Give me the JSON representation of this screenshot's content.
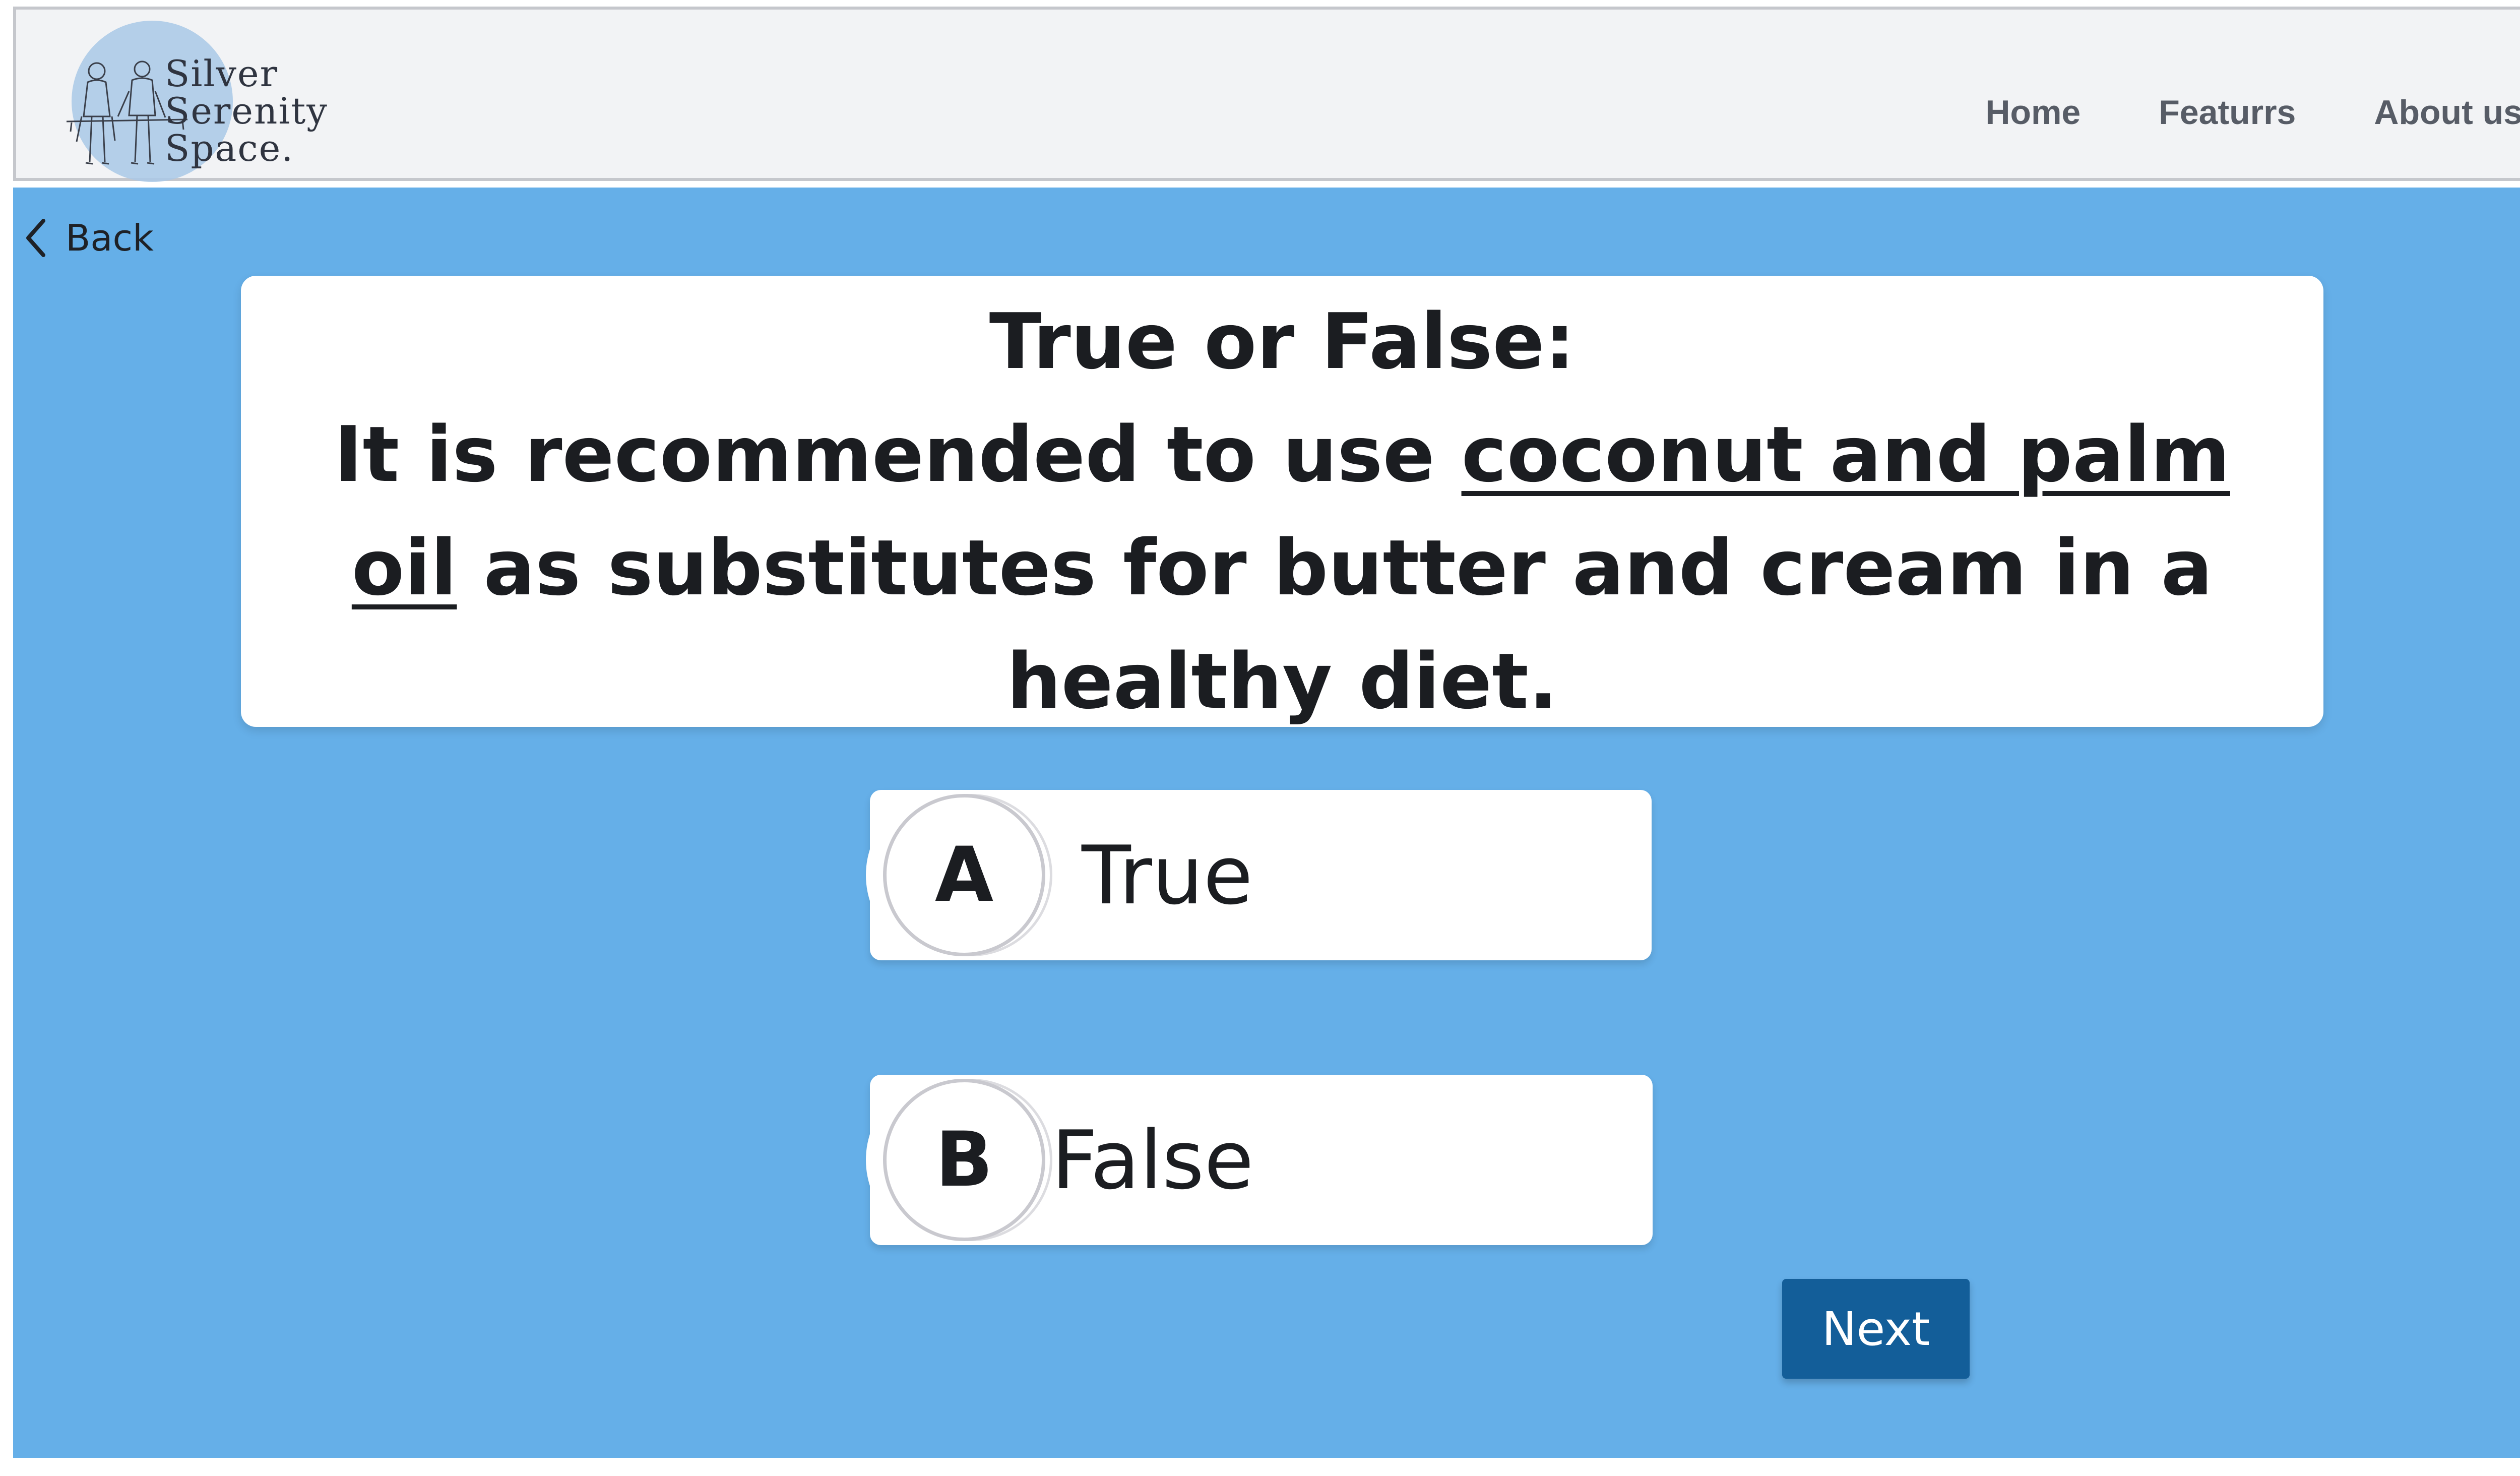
{
  "header": {
    "logo": {
      "line1": "Silver",
      "line2": "Serenity",
      "line3": "Space."
    },
    "nav": [
      {
        "label": "Home"
      },
      {
        "label": "Featurrs"
      },
      {
        "label": "About us"
      }
    ]
  },
  "main": {
    "back_label": "Back",
    "question": {
      "heading": "True or False:",
      "text_before": "It is recommended to use ",
      "text_underlined": "coconut and palm oil",
      "text_after": " as substitutes for butter and cream in a healthy diet."
    },
    "options": [
      {
        "letter": "A",
        "label": "True"
      },
      {
        "letter": "B",
        "label": "False"
      }
    ],
    "next_label": "Next"
  },
  "colors": {
    "page_background": "#65afe8",
    "header_background": "#f2f3f5",
    "next_button": "#135e99",
    "nav_text": "#575c66",
    "logo_circle": "#a9c8e6"
  },
  "icons": {
    "back": "chevron-left-icon",
    "logo_illustration": "elderly-couple-sketch"
  }
}
